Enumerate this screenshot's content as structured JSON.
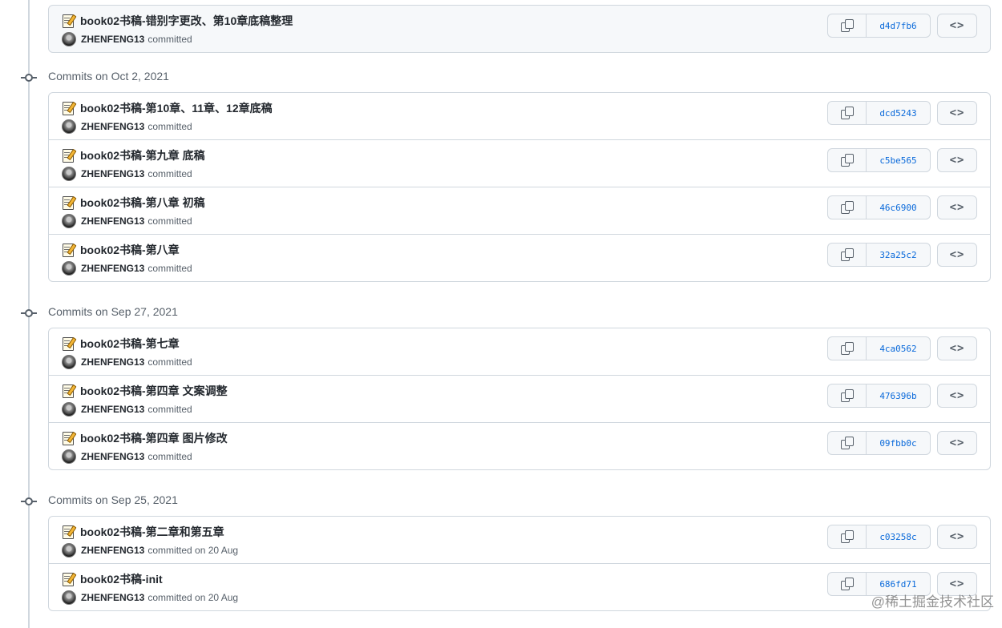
{
  "top_group": {
    "commits": [
      {
        "title": "book02书稿-错别字更改、第10章底稿整理",
        "author": "ZHENFENG13",
        "committed": "committed",
        "sha": "d4d7fb6"
      }
    ]
  },
  "groups": [
    {
      "label": "Commits on Oct 2, 2021",
      "commits": [
        {
          "title": "book02书稿-第10章、11章、12章底稿",
          "author": "ZHENFENG13",
          "committed": "committed",
          "sha": "dcd5243"
        },
        {
          "title": "book02书稿-第九章 底稿",
          "author": "ZHENFENG13",
          "committed": "committed",
          "sha": "c5be565"
        },
        {
          "title": "book02书稿-第八章 初稿",
          "author": "ZHENFENG13",
          "committed": "committed",
          "sha": "46c6900"
        },
        {
          "title": "book02书稿-第八章",
          "author": "ZHENFENG13",
          "committed": "committed",
          "sha": "32a25c2"
        }
      ]
    },
    {
      "label": "Commits on Sep 27, 2021",
      "commits": [
        {
          "title": "book02书稿-第七章",
          "author": "ZHENFENG13",
          "committed": "committed",
          "sha": "4ca0562"
        },
        {
          "title": "book02书稿-第四章 文案调整",
          "author": "ZHENFENG13",
          "committed": "committed",
          "sha": "476396b"
        },
        {
          "title": "book02书稿-第四章 图片修改",
          "author": "ZHENFENG13",
          "committed": "committed",
          "sha": "09fbb0c"
        }
      ]
    },
    {
      "label": "Commits on Sep 25, 2021",
      "commits": [
        {
          "title": "book02书稿-第二章和第五章",
          "author": "ZHENFENG13",
          "committed": "committed on 20 Aug",
          "sha": "c03258c"
        },
        {
          "title": "book02书稿-init",
          "author": "ZHENFENG13",
          "committed": "committed on 20 Aug",
          "sha": "686fd71"
        }
      ]
    }
  ],
  "icons": {
    "commit_title": "memo-icon",
    "copy": "copy-icon",
    "browse": "code-icon",
    "timeline": "git-commit-icon"
  },
  "watermark": "@稀土掘金技术社区"
}
